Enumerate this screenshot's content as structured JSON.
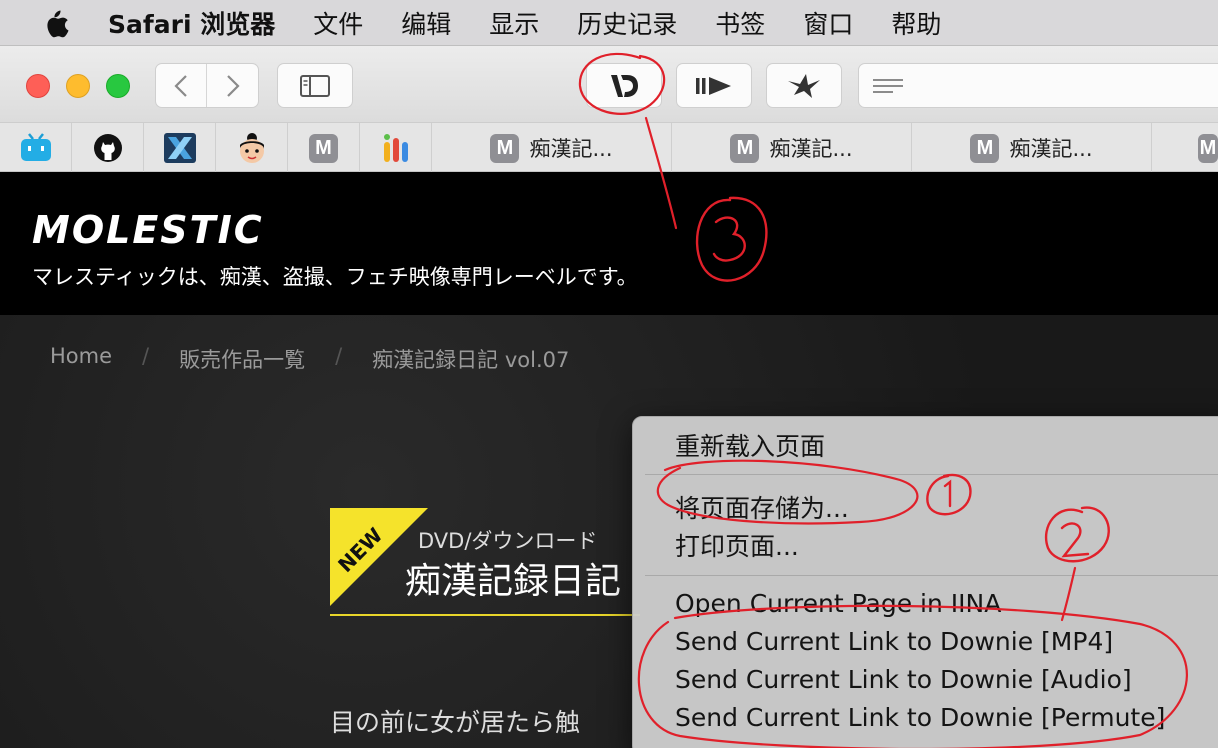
{
  "menubar": {
    "app_name": "Safari 浏览器",
    "items": [
      "文件",
      "编辑",
      "显示",
      "历史记录",
      "书签",
      "窗口",
      "帮助"
    ]
  },
  "toolbar": {
    "icons": {
      "back": "chevron-left-icon",
      "forward": "chevron-right-icon",
      "sidebar": "sidebar-icon",
      "downie": "downie-icon",
      "reader": "reader-play-icon",
      "bird": "bird-icon",
      "address": "reader-lines-icon"
    }
  },
  "favorites": {
    "badge_letter": "M",
    "tab_label": "痴漢記..."
  },
  "page": {
    "logo": "MOLESTIC",
    "tagline": "マレスティックは、痴漢、盗撮、フェチ映像専門レーベルです。",
    "breadcrumb": [
      "Home",
      "販売作品一覧",
      "痴漢記録日記 vol.07"
    ],
    "breadcrumb_sep": "/",
    "ribbon": "NEW",
    "product_kind": "DVD/ダウンロード",
    "product_title": "痴漢記録日記",
    "product_desc": "目の前に女が居たら触"
  },
  "context_menu": {
    "items": [
      "重新载入页面",
      "将页面存储为...",
      "打印页面...",
      "Open Current Page in IINA",
      "Send Current Link to Downie [MP4]",
      "Send Current Link to Downie [Audio]",
      "Send Current Link to Downie [Permute]"
    ]
  },
  "annotations": {
    "color": "#e0202a",
    "labels": [
      "①",
      "②",
      "③"
    ]
  }
}
